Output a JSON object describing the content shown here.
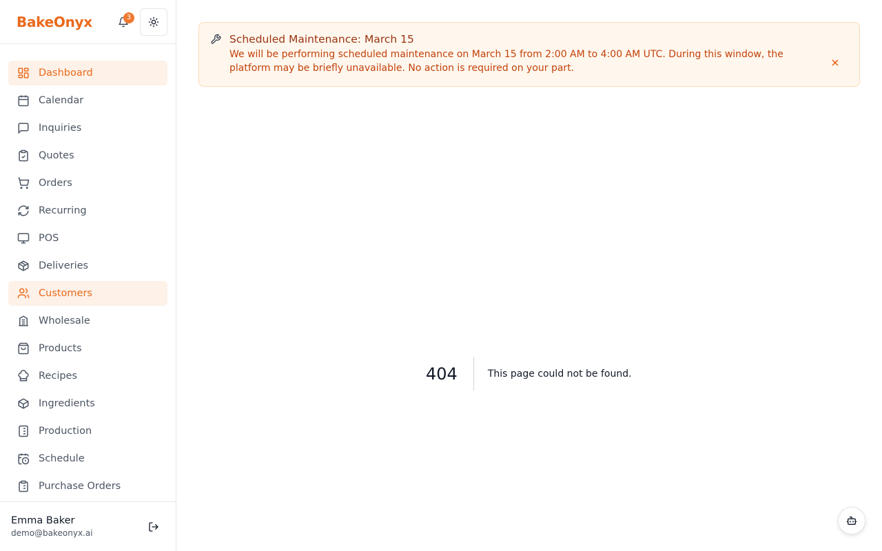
{
  "brand": {
    "name": "BakeOnyx",
    "color": "#ea6a1c"
  },
  "header": {
    "notifications_count": "3"
  },
  "sidebar": {
    "items": [
      {
        "label": "Dashboard",
        "icon": "dashboard-icon",
        "active": true
      },
      {
        "label": "Calendar",
        "icon": "calendar-icon",
        "active": false
      },
      {
        "label": "Inquiries",
        "icon": "message-icon",
        "active": false
      },
      {
        "label": "Quotes",
        "icon": "clipboard-check-icon",
        "active": false
      },
      {
        "label": "Orders",
        "icon": "cart-icon",
        "active": false
      },
      {
        "label": "Recurring",
        "icon": "refresh-icon",
        "active": false
      },
      {
        "label": "POS",
        "icon": "monitor-icon",
        "active": false
      },
      {
        "label": "Deliveries",
        "icon": "package-icon",
        "active": false
      },
      {
        "label": "Customers",
        "icon": "users-icon",
        "active": true
      },
      {
        "label": "Wholesale",
        "icon": "building-icon",
        "active": false
      },
      {
        "label": "Products",
        "icon": "shopping-bag-icon",
        "active": false
      },
      {
        "label": "Recipes",
        "icon": "chef-hat-icon",
        "active": false
      },
      {
        "label": "Ingredients",
        "icon": "box-icon",
        "active": false
      },
      {
        "label": "Production",
        "icon": "list-checks-icon",
        "active": false
      },
      {
        "label": "Schedule",
        "icon": "calendar-clock-icon",
        "active": false
      },
      {
        "label": "Purchase Orders",
        "icon": "clipboard-list-icon",
        "active": false
      }
    ]
  },
  "user": {
    "name": "Emma Baker",
    "email": "demo@bakeonyx.ai"
  },
  "banner": {
    "title": "Scheduled Maintenance: March 15",
    "text": "We will be performing scheduled maintenance on March 15 from 2:00 AM to 4:00 AM UTC. During this window, the platform may be briefly unavailable. No action is required on your part."
  },
  "not_found": {
    "code": "404",
    "message": "This page could not be found."
  }
}
